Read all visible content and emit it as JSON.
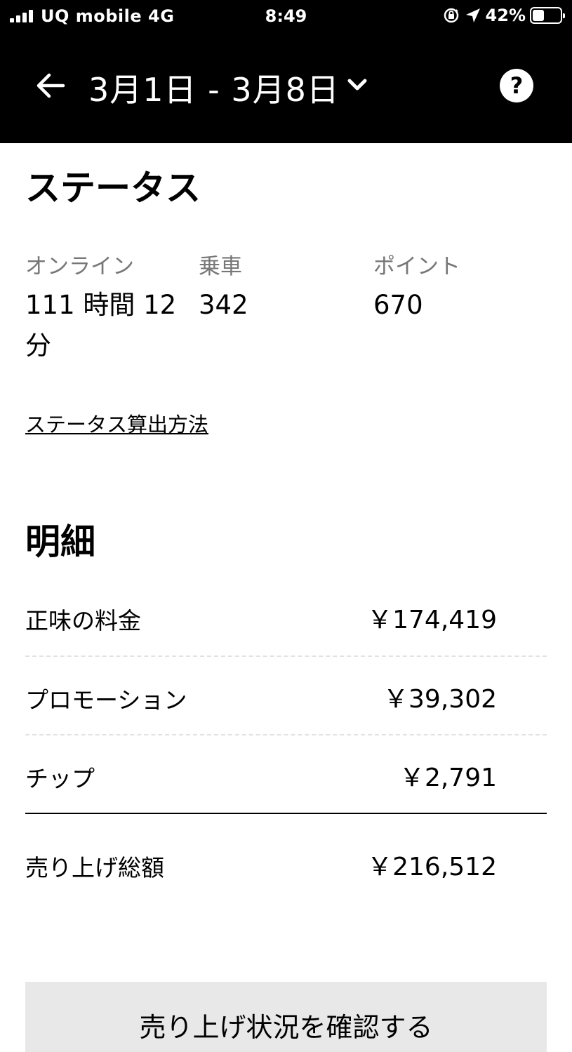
{
  "status_bar": {
    "carrier": "UQ mobile  4G",
    "time": "8:49",
    "battery_percent": "42%",
    "battery_level": 0.42
  },
  "header": {
    "date_range": "3月1日 - 3月8日",
    "help_label": "?"
  },
  "status": {
    "title": "ステータス",
    "online_label": "オンライン",
    "online_value": "111 時間 12 分",
    "rides_label": "乗車",
    "rides_value": "342",
    "points_label": "ポイント",
    "points_value": "670",
    "method_link": "ステータス算出方法"
  },
  "breakdown": {
    "title": "明細",
    "rows": [
      {
        "label": "正味の料金",
        "value": "￥174,419"
      },
      {
        "label": "プロモーション",
        "value": "￥39,302"
      },
      {
        "label": "チップ",
        "value": "￥2,791"
      }
    ],
    "total_label": "売り上げ総額",
    "total_value": "￥216,512"
  },
  "bottom_button": {
    "label": "売り上げ状況を確認する"
  },
  "colors": {
    "header_bg": "#000000",
    "muted_text": "#777777",
    "button_bg": "#e8e8e8"
  }
}
